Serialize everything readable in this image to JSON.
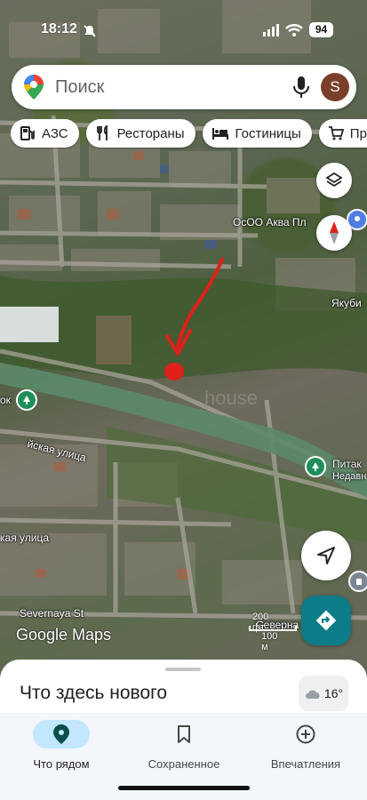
{
  "status_bar": {
    "time": "18:12",
    "battery": "94"
  },
  "search": {
    "placeholder": "Поиск",
    "avatar_letter": "S"
  },
  "chips": [
    {
      "label": "АЗС",
      "icon": "gas-station-icon"
    },
    {
      "label": "Рестораны",
      "icon": "restaurant-icon"
    },
    {
      "label": "Гостиницы",
      "icon": "hotel-icon"
    },
    {
      "label": "Про",
      "icon": "cart-icon"
    }
  ],
  "map": {
    "labels": {
      "place_top": "ОсОО Аква Пл",
      "place_right": "Якуби",
      "street_1": "йская улица",
      "street_2": "кая улица",
      "street_3": "Severnaya St",
      "street_4": "Северна",
      "poi_left": "ок",
      "poi_right": "Питак",
      "poi_right_sub": "Недавн"
    },
    "watermark": "house",
    "logo": "Google Maps",
    "scale": {
      "ft": "200 фт",
      "m": "100 м"
    },
    "colors": {
      "pin": "#e0201a",
      "poi": "#1e8e5a",
      "directions": "#0b7c88"
    }
  },
  "sheet": {
    "title": "Что здесь нового",
    "weather": "16°"
  },
  "nav": {
    "items": [
      {
        "label": "Что рядом",
        "icon": "location-pin-icon",
        "active": true
      },
      {
        "label": "Сохраненное",
        "icon": "bookmark-icon",
        "active": false
      },
      {
        "label": "Впечатления",
        "icon": "add-circle-icon",
        "active": false
      }
    ]
  }
}
